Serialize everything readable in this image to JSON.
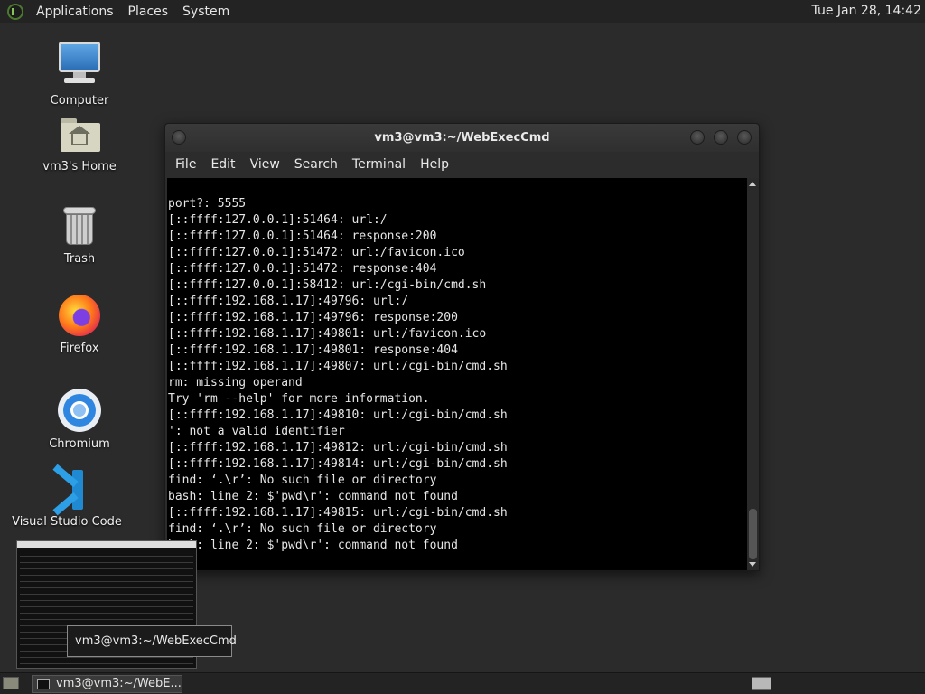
{
  "top_panel": {
    "menus": [
      "Applications",
      "Places",
      "System"
    ],
    "clock": "Tue Jan 28, 14:42"
  },
  "desktop_icons": [
    {
      "label": "Computer",
      "icon": "computer-icon"
    },
    {
      "label": "vm3's Home",
      "icon": "home-folder-icon"
    },
    {
      "label": "Trash",
      "icon": "trash-icon"
    },
    {
      "label": "Firefox",
      "icon": "firefox-icon"
    },
    {
      "label": "Chromium",
      "icon": "chromium-icon"
    },
    {
      "label": "Visual Studio Code",
      "icon": "vscode-icon"
    }
  ],
  "terminal": {
    "title": "vm3@vm3:~/WebExecCmd",
    "menu": [
      "File",
      "Edit",
      "View",
      "Search",
      "Terminal",
      "Help"
    ],
    "lines": [
      "port?: 5555",
      "[::ffff:127.0.0.1]:51464: url:/",
      "[::ffff:127.0.0.1]:51464: response:200",
      "[::ffff:127.0.0.1]:51472: url:/favicon.ico",
      "[::ffff:127.0.0.1]:51472: response:404",
      "[::ffff:127.0.0.1]:58412: url:/cgi-bin/cmd.sh",
      "[::ffff:192.168.1.17]:49796: url:/",
      "[::ffff:192.168.1.17]:49796: response:200",
      "[::ffff:192.168.1.17]:49801: url:/favicon.ico",
      "[::ffff:192.168.1.17]:49801: response:404",
      "[::ffff:192.168.1.17]:49807: url:/cgi-bin/cmd.sh",
      "rm: missing operand",
      "Try 'rm --help' for more information.",
      "[::ffff:192.168.1.17]:49810: url:/cgi-bin/cmd.sh",
      "': not a valid identifier",
      "[::ffff:192.168.1.17]:49812: url:/cgi-bin/cmd.sh",
      "[::ffff:192.168.1.17]:49814: url:/cgi-bin/cmd.sh",
      "find: ‘.\\r’: No such file or directory",
      "bash: line 2: $'pwd\\r': command not found",
      "[::ffff:192.168.1.17]:49815: url:/cgi-bin/cmd.sh",
      "find: ‘.\\r’: No such file or directory",
      "bash: line 2: $'pwd\\r': command not found"
    ]
  },
  "tooltip": "vm3@vm3:~/WebExecCmd",
  "taskbar": {
    "task_label": "vm3@vm3:~/WebE..."
  }
}
